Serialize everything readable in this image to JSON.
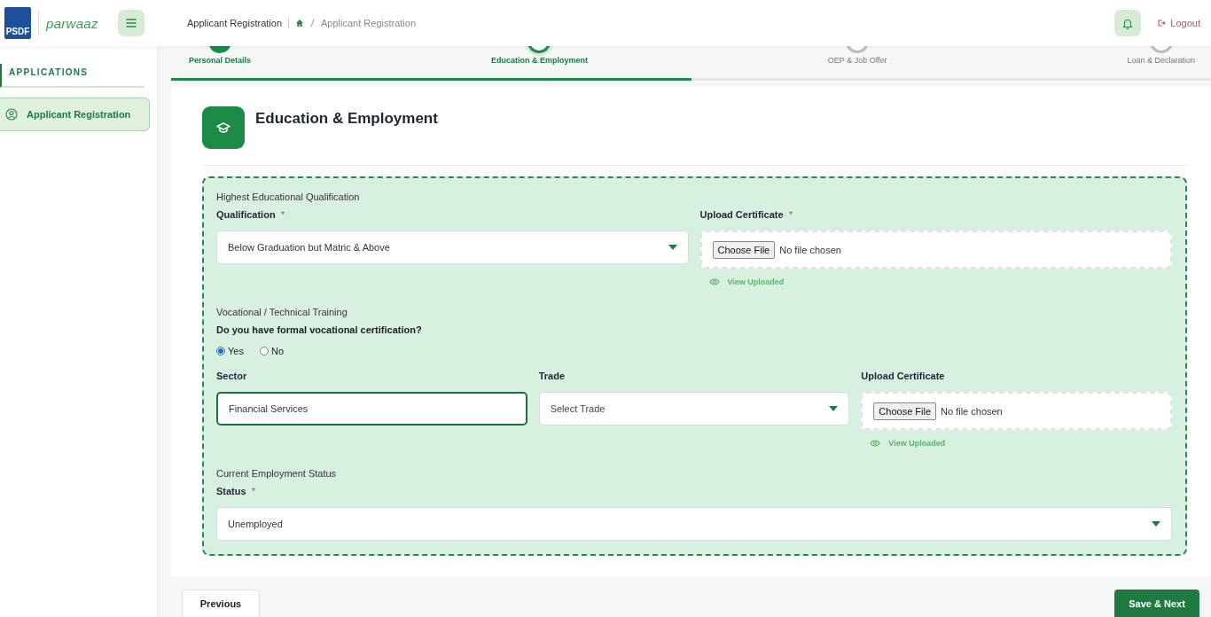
{
  "header": {
    "logo_text": "PSDF",
    "brand": "parwaaz",
    "breadcrumb_title": "Applicant Registration",
    "breadcrumb_current": "Applicant Registration",
    "logout": "Logout"
  },
  "sidebar": {
    "heading": "APPLICATIONS",
    "items": [
      {
        "label": "Applicant Registration",
        "selected": true
      }
    ]
  },
  "stepper": {
    "level": 0.5,
    "steps": [
      {
        "label": "Personal Details",
        "completed": true,
        "selected": false
      },
      {
        "label": "Education & Employment",
        "completed": false,
        "selected": true
      },
      {
        "label": "OEP & Job Offer",
        "completed": false,
        "selected": false
      },
      {
        "label": "Loan & Declaration",
        "completed": false,
        "selected": false
      }
    ]
  },
  "page_title": "Education & Employment",
  "sections": [
    {
      "title": "Highest Educational Qualification",
      "fields": [
        {
          "kind": "select",
          "label": "Qualification",
          "required_mark": "*",
          "value": "Below Graduation but Matric & Above"
        },
        {
          "kind": "file",
          "label": "Upload Certificate",
          "required_mark": "*",
          "button": "Choose File",
          "status": "No file chosen",
          "link": "View Uploaded"
        }
      ]
    },
    {
      "title": "Vocational / Technical Training",
      "question": "Do you have formal vocational certification?",
      "options": [
        {
          "label": "Yes",
          "selected": true
        },
        {
          "label": "No",
          "selected": false
        }
      ],
      "fields": [
        {
          "kind": "text",
          "label": "Sector",
          "value": "Financial Services",
          "focused": true
        },
        {
          "kind": "select",
          "label": "Trade",
          "placeholder": "Select Trade"
        },
        {
          "kind": "file",
          "label": "Upload Certificate",
          "button": "Choose File",
          "status": "No file chosen",
          "link": "View Uploaded"
        }
      ]
    },
    {
      "title": "Current Employment Status",
      "fields": [
        {
          "kind": "select",
          "label": "Status",
          "required_mark": "*",
          "value": "Unemployed"
        }
      ]
    }
  ],
  "footer": {
    "previous": "Previous",
    "next": "Save & Next"
  }
}
